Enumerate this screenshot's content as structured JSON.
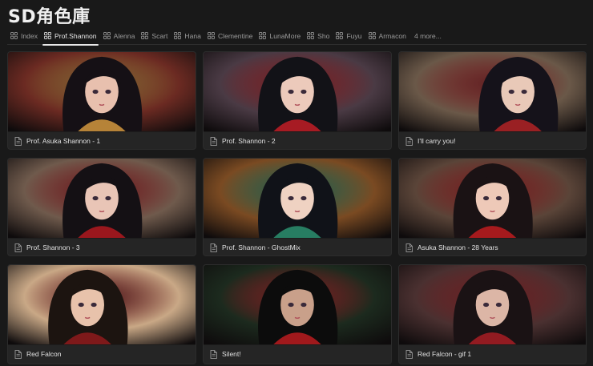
{
  "page": {
    "title": "SD角色庫"
  },
  "tabs": [
    {
      "label": "Index",
      "active": false
    },
    {
      "label": "Prof.Shannon",
      "active": true
    },
    {
      "label": "Alenna",
      "active": false
    },
    {
      "label": "Scart",
      "active": false
    },
    {
      "label": "Hana",
      "active": false
    },
    {
      "label": "Clementine",
      "active": false
    },
    {
      "label": "LunaMore",
      "active": false
    },
    {
      "label": "Sho",
      "active": false
    },
    {
      "label": "Fuyu",
      "active": false
    },
    {
      "label": "Armacon",
      "active": false
    }
  ],
  "more_label": "4 more...",
  "cards": [
    {
      "caption": "Prof. Asuka Shannon - 1",
      "bg": "#6b2a22",
      "accent": "#c8903c",
      "hair": "#151015",
      "skin": "#e8c0ae"
    },
    {
      "caption": "Prof. Shannon - 2",
      "bg": "#4a3a44",
      "accent": "#b81d25",
      "hair": "#121217",
      "skin": "#eccabb"
    },
    {
      "caption": "I'll carry you!",
      "bg": "#6a5848",
      "accent": "#a82225",
      "hair": "#15121a",
      "skin": "#e9c9b8"
    },
    {
      "caption": "Prof. Shannon - 3",
      "bg": "#6f5a4c",
      "accent": "#a8181e",
      "hair": "#141014",
      "skin": "#e9c5b6"
    },
    {
      "caption": "Prof. Shannon - GhostMix",
      "bg": "#7a4a22",
      "accent": "#2a8a6a",
      "hair": "#101218",
      "skin": "#efd2c2"
    },
    {
      "caption": "Asuka Shannon - 28 Years",
      "bg": "#5a4438",
      "accent": "#b61c1e",
      "hair": "#1a1214",
      "skin": "#eec9b8"
    },
    {
      "caption": "Red Falcon",
      "bg": "#c9a886",
      "accent": "#8a1a1c",
      "hair": "#1c1410",
      "skin": "#e8c2ab"
    },
    {
      "caption": "Silent!",
      "bg": "#1c2a1e",
      "accent": "#b01b1e",
      "hair": "#0c0c0c",
      "skin": "#c9a08a"
    },
    {
      "caption": "Red Falcon - gif 1",
      "bg": "#4a3030",
      "accent": "#a01d22",
      "hair": "#1a1214",
      "skin": "#dcb6a6"
    }
  ]
}
